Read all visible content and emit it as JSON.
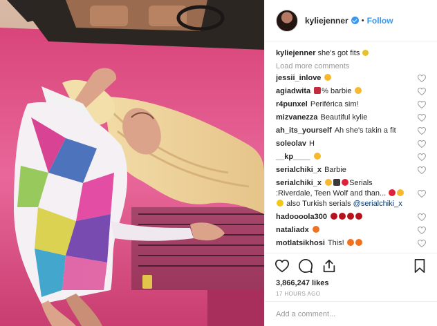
{
  "header": {
    "username": "kyliejenner",
    "separator": "•",
    "follow_label": "Follow"
  },
  "caption": {
    "author": "kyliejenner",
    "text": "she's got fits"
  },
  "load_more_label": "Load more comments",
  "comments": [
    {
      "author": "jessii_inlove",
      "text": ""
    },
    {
      "author": "agiadwita",
      "text": "% barbie"
    },
    {
      "author": "r4punxel",
      "text": "Periférica sim!"
    },
    {
      "author": "mizvanezza",
      "text": "Beautiful kylie"
    },
    {
      "author": "ah_its_yourself",
      "text": "Ah she's takin a fit"
    },
    {
      "author": "soleolav",
      "text": "H"
    },
    {
      "author": "__kp____",
      "text": ""
    },
    {
      "author": "serialchiki_x",
      "text": "Barbie"
    },
    {
      "author": "serialchiki_x",
      "text": "Serials :Riverdale, Teen Wolf and than...",
      "text2": "also Turkish serials",
      "mention": "@serialchiki_x"
    },
    {
      "author": "hadoooola300",
      "text": ""
    },
    {
      "author": "nataliadx",
      "text": ""
    },
    {
      "author": "motlatsikhosi",
      "text": "This!"
    }
  ],
  "likes": "3,866,247 likes",
  "timestamp": "17 HOURS AGO",
  "add_comment": {
    "placeholder": "Add a comment..."
  },
  "icons": {
    "like": "heart-icon",
    "comment": "comment-icon",
    "share": "share-icon",
    "save": "bookmark-icon",
    "verified": "verified-badge-icon"
  },
  "colors": {
    "accent": "#3897f0",
    "car_pink": "#e0507f",
    "muted_text": "#999999"
  }
}
